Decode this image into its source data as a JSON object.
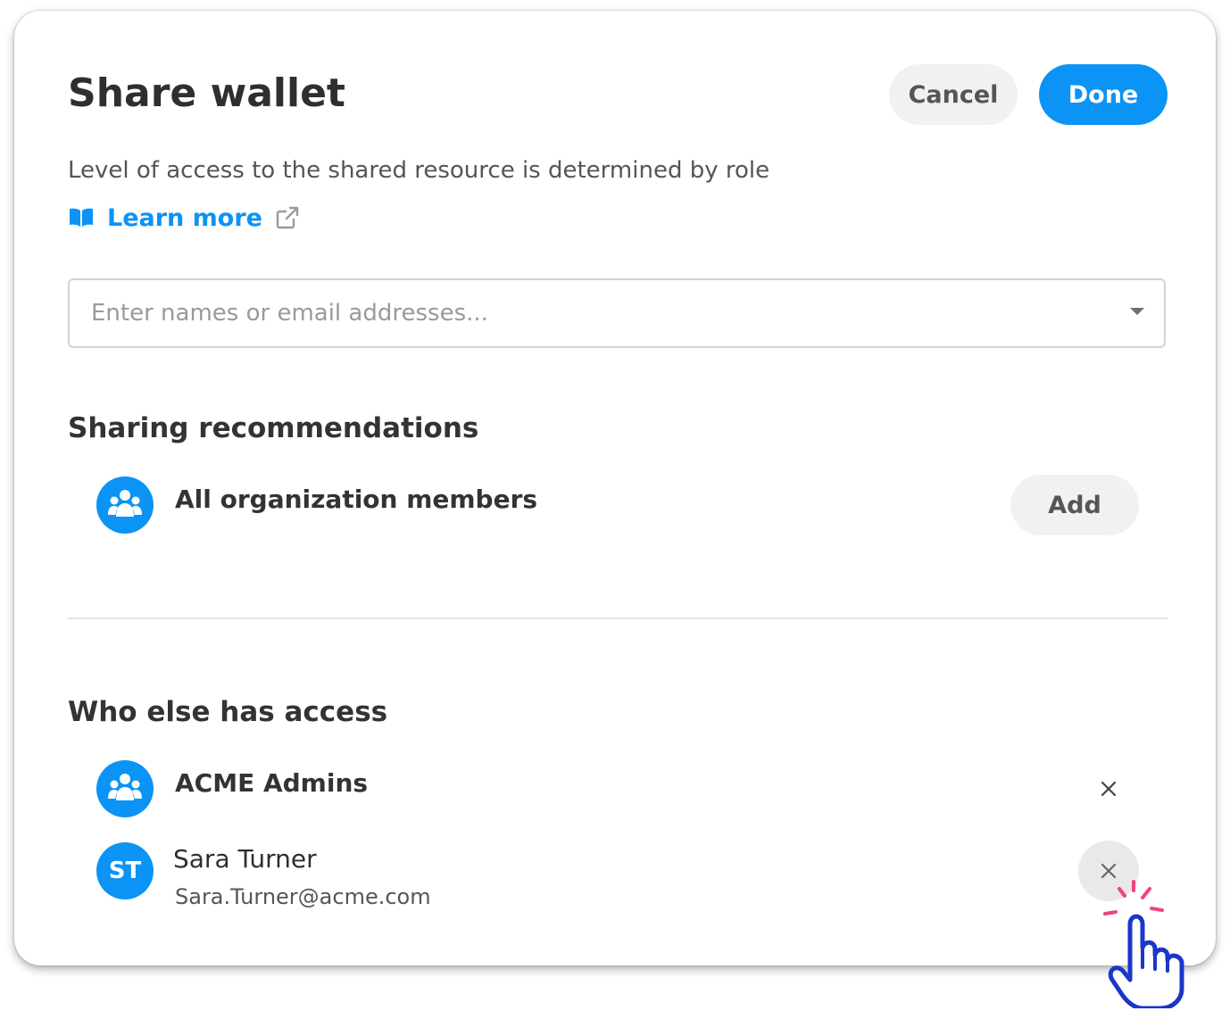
{
  "dialog": {
    "title": "Share wallet",
    "cancel_label": "Cancel",
    "done_label": "Done",
    "description": "Level of access to the shared resource is determined by role",
    "learn_more_label": "Learn more",
    "search_placeholder": "Enter names or email addresses..."
  },
  "recommendations": {
    "heading": "Sharing recommendations",
    "items": [
      {
        "name": "All organization members",
        "action_label": "Add",
        "icon": "group-icon"
      }
    ]
  },
  "access": {
    "heading": "Who else has access",
    "items": [
      {
        "name": "ACME Admins",
        "icon": "group-icon"
      },
      {
        "initials": "ST",
        "name": "Sara Turner",
        "email": "Sara.Turner@acme.com"
      }
    ]
  },
  "colors": {
    "accent": "#0b93f6",
    "click_burst": "#f0447a",
    "cursor_outline": "#1a37c9"
  }
}
